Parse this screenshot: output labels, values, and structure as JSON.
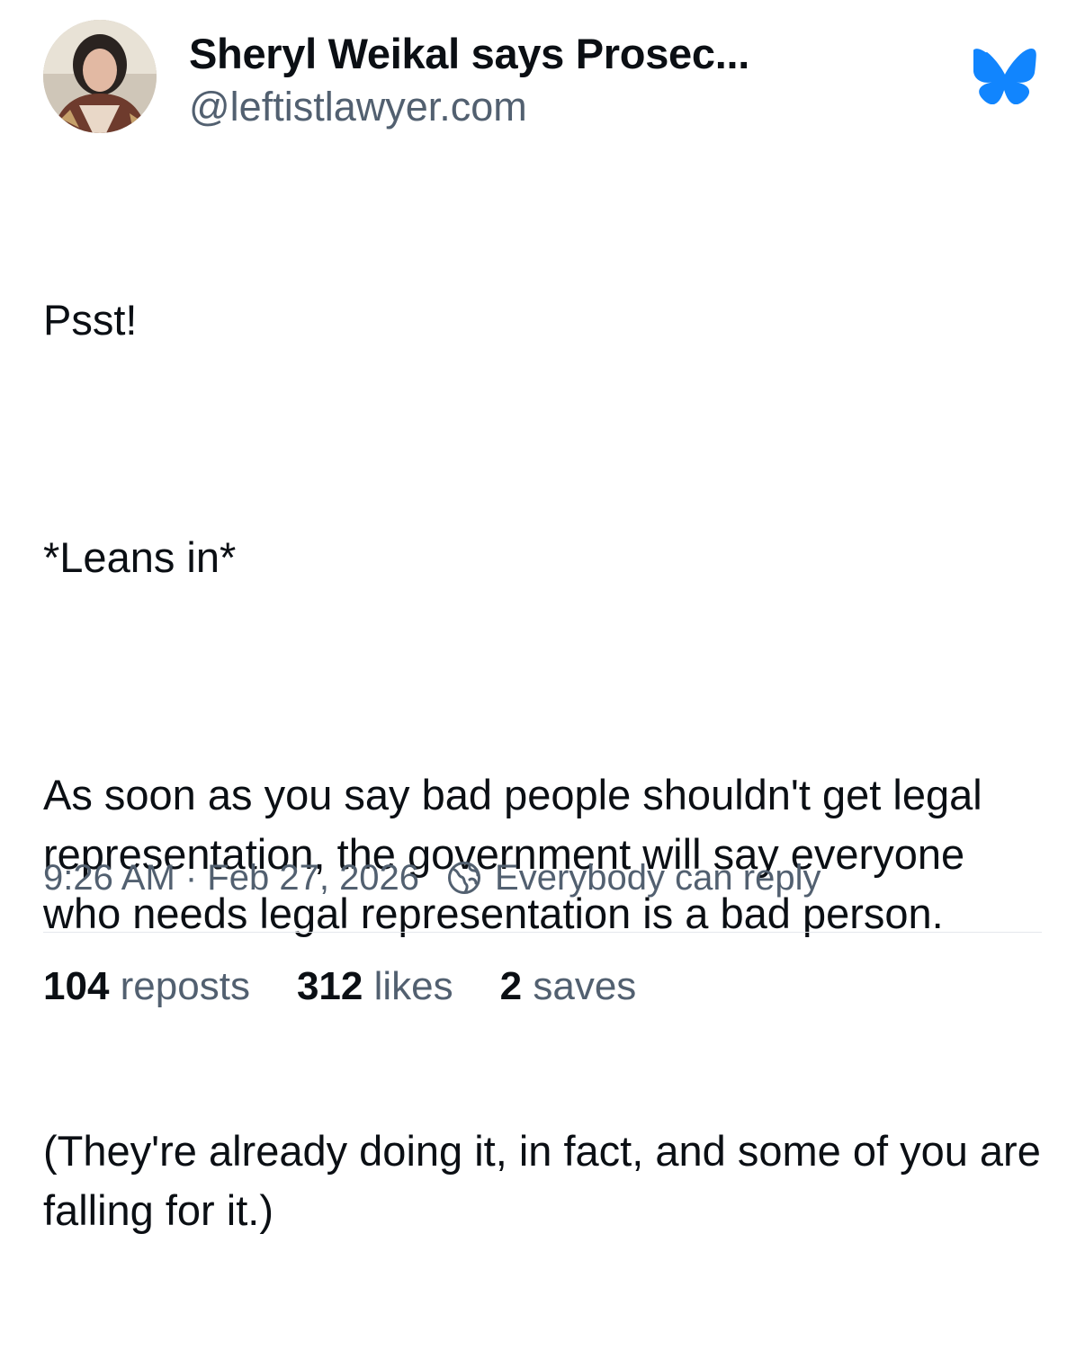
{
  "author": {
    "display_name": "Sheryl Weikal says Prosec...",
    "handle": "@leftistlawyer.com"
  },
  "icons": {
    "avatar": "profile-photo",
    "logo": "bluesky-butterfly-icon",
    "reply_setting": "globe-icon"
  },
  "colors": {
    "brand": "#1185fe",
    "secondary_text": "#526070"
  },
  "post": {
    "paragraphs": [
      "Psst!",
      "*Leans in*",
      "As soon as you say bad people shouldn't get legal representation, the government will say everyone who needs legal representation is a bad person.",
      "(They're already doing it, in fact, and some of you are falling for it.)"
    ],
    "timestamp": "9:26 AM · Feb 27, 2026",
    "reply_setting": "Everybody can reply"
  },
  "stats": {
    "reposts_count": "104",
    "reposts_label": "reposts",
    "likes_count": "312",
    "likes_label": "likes",
    "saves_count": "2",
    "saves_label": "saves"
  }
}
